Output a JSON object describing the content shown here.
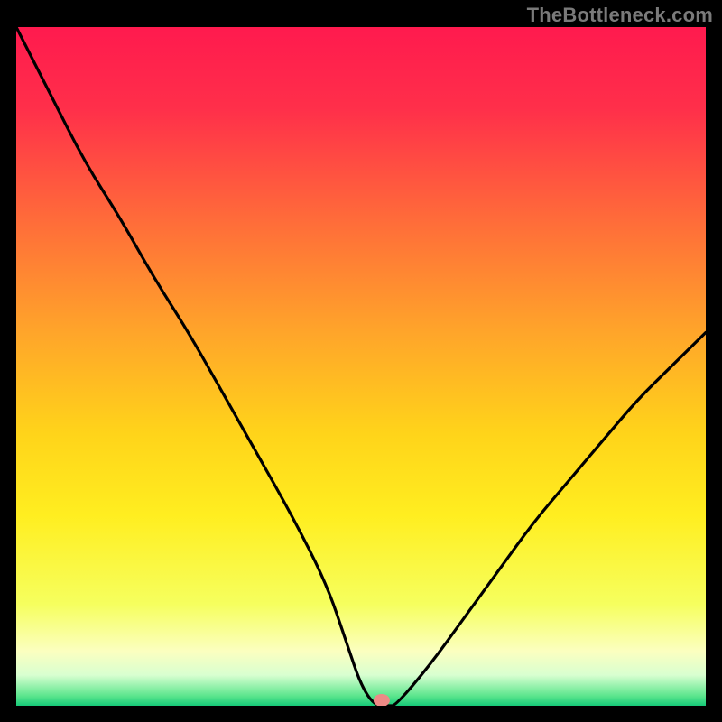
{
  "watermark": "TheBottleneck.com",
  "chart_data": {
    "type": "line",
    "title": "",
    "xlabel": "",
    "ylabel": "",
    "xlim": [
      0,
      100
    ],
    "ylim": [
      0,
      100
    ],
    "x": [
      0,
      5,
      10,
      15,
      20,
      25,
      30,
      35,
      40,
      45,
      48,
      50,
      52,
      54,
      55,
      60,
      65,
      70,
      75,
      80,
      85,
      90,
      95,
      100
    ],
    "y": [
      100,
      90,
      80,
      72,
      63,
      55,
      46,
      37,
      28,
      18,
      9,
      3,
      0,
      0,
      0,
      6,
      13,
      20,
      27,
      33,
      39,
      45,
      50,
      55
    ],
    "marker": {
      "x": 53,
      "y": 0.8
    },
    "gradient_stops": [
      {
        "pos": 0.0,
        "color": "#ff1a4e"
      },
      {
        "pos": 0.12,
        "color": "#ff2f4a"
      },
      {
        "pos": 0.28,
        "color": "#ff6a3a"
      },
      {
        "pos": 0.45,
        "color": "#ffa52a"
      },
      {
        "pos": 0.6,
        "color": "#ffd41a"
      },
      {
        "pos": 0.72,
        "color": "#ffee20"
      },
      {
        "pos": 0.85,
        "color": "#f6ff5e"
      },
      {
        "pos": 0.92,
        "color": "#fbffc0"
      },
      {
        "pos": 0.955,
        "color": "#d8ffd0"
      },
      {
        "pos": 0.985,
        "color": "#5ee68e"
      },
      {
        "pos": 1.0,
        "color": "#16c978"
      }
    ]
  }
}
